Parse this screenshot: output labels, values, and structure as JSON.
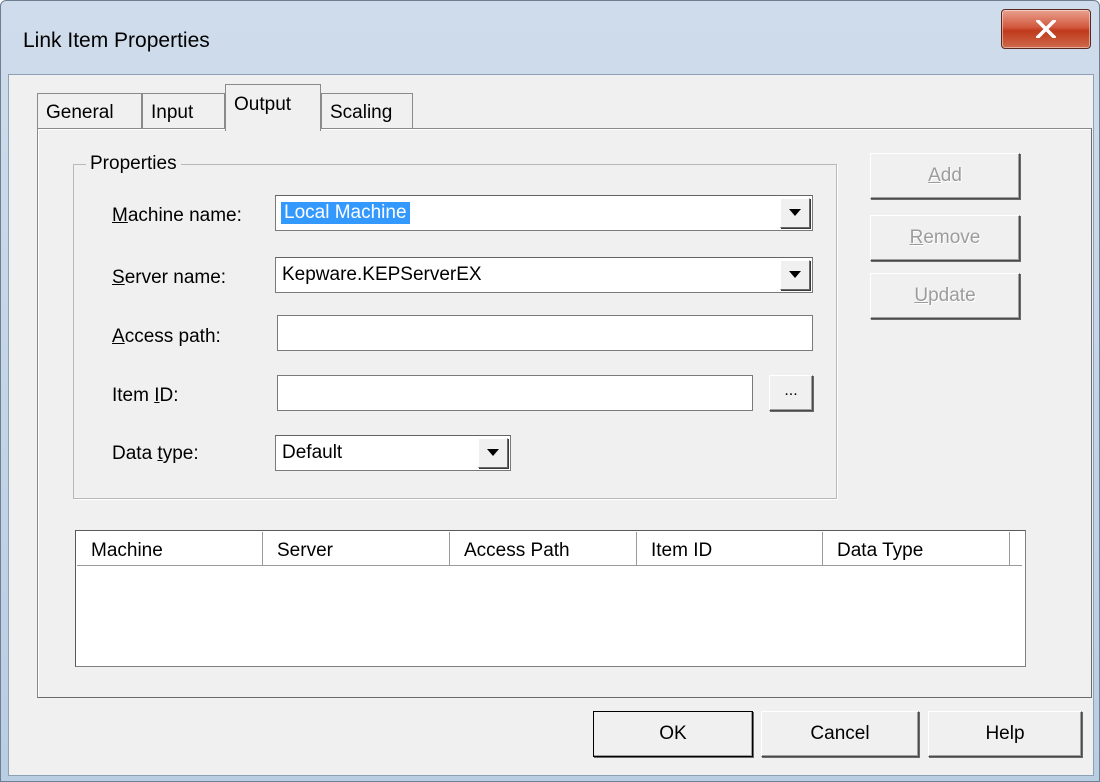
{
  "window": {
    "title": "Link Item Properties",
    "close_glyph": "×",
    "close_icon": "close-x-icon",
    "accent_close": "#c03a1c"
  },
  "tabs": [
    {
      "label": "General",
      "active": false
    },
    {
      "label": "Input",
      "active": false
    },
    {
      "label": "Output",
      "active": true
    },
    {
      "label": "Scaling",
      "active": false
    }
  ],
  "properties": {
    "group_label": "Properties",
    "machine_name": {
      "label_mnemonic": "M",
      "label_rest": "achine name:",
      "value": "Local Machine"
    },
    "server_name": {
      "label_mnemonic": "S",
      "label_rest": "erver name:",
      "value": "Kepware.KEPServerEX"
    },
    "access_path": {
      "label_mnemonic": "A",
      "label_rest": "ccess path:",
      "value": ""
    },
    "item_id": {
      "label_pre": "Item ",
      "label_mnemonic": "I",
      "label_rest": "D:",
      "value": "",
      "browse_label": "..."
    },
    "data_type": {
      "label_pre": "Data ",
      "label_mnemonic": "t",
      "label_rest": "ype:",
      "value": "Default"
    }
  },
  "side_buttons": {
    "add": {
      "mnemonic": "A",
      "rest": "dd"
    },
    "remove": {
      "mnemonic": "R",
      "rest": "emove"
    },
    "update": {
      "mnemonic": "U",
      "rest": "pdate"
    }
  },
  "list": {
    "columns": [
      "Machine",
      "Server",
      "Access Path",
      "Item ID",
      "Data Type"
    ],
    "rows": []
  },
  "footer": {
    "ok": "OK",
    "cancel": "Cancel",
    "help": "Help"
  },
  "icons": {
    "dropdown": "chevron-down-icon"
  }
}
